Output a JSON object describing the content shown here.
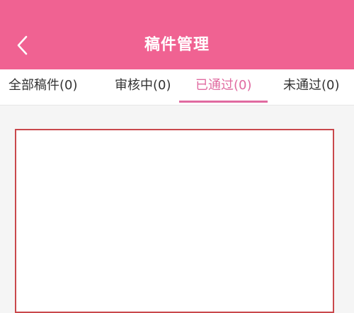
{
  "header": {
    "title": "稿件管理",
    "back_icon": "chevron-left-icon",
    "background_color": "#f06292",
    "title_color": "#ffffff"
  },
  "tabs": [
    {
      "label": "全部稿件(0)",
      "active": false
    },
    {
      "label": "审核中(0)",
      "active": false
    },
    {
      "label": "已通过(0)",
      "active": true
    },
    {
      "label": "未通过(0)",
      "active": false
    }
  ],
  "colors": {
    "tab_active": "#e06aa0",
    "tab_inactive": "#333333",
    "highlight_border": "#c9484c",
    "page_background": "#f5f5f5"
  }
}
